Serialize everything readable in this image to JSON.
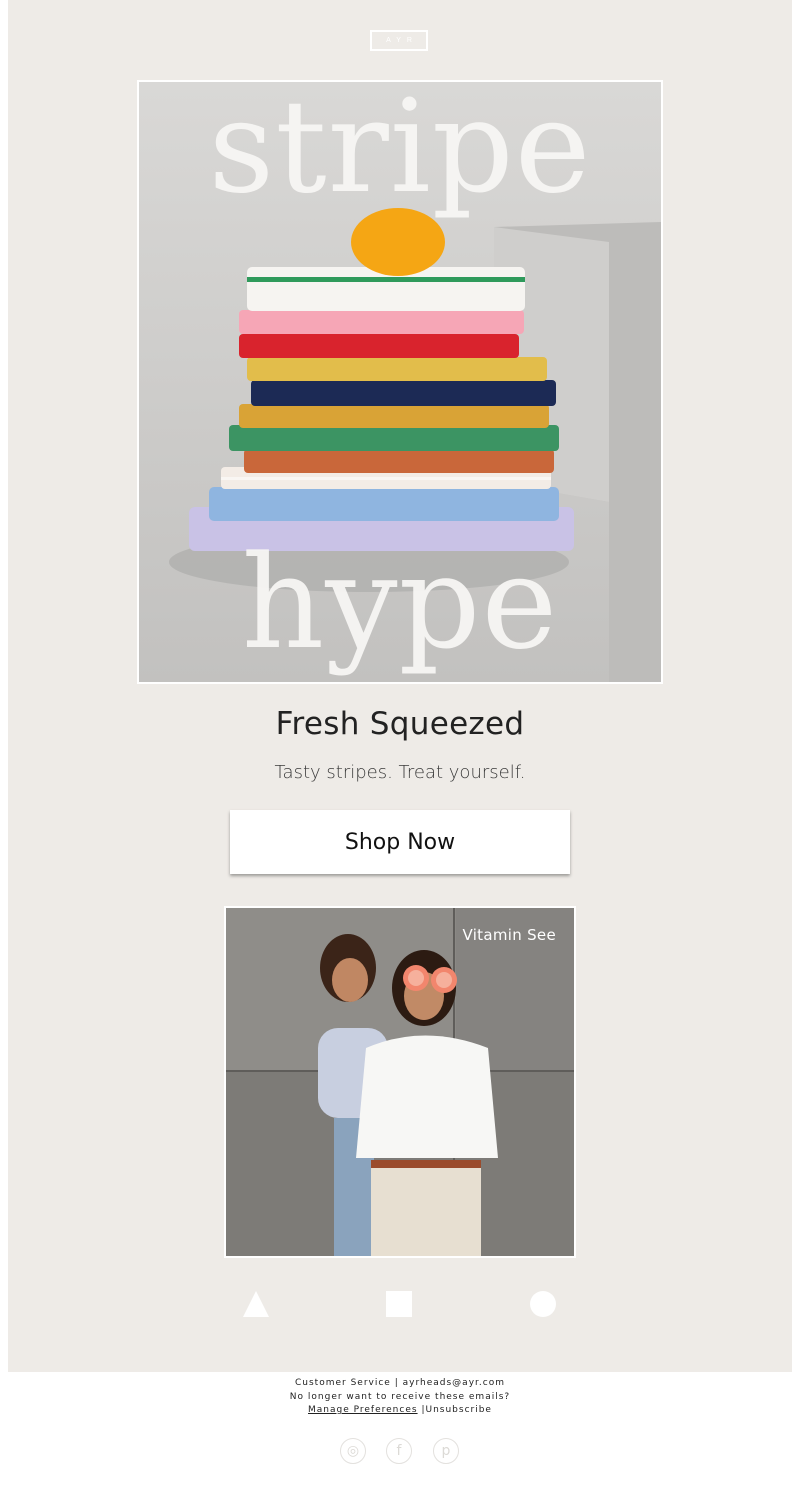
{
  "brand": {
    "logo_text": "AYR"
  },
  "hero": {
    "word_top": "stripe",
    "word_bottom": "hype"
  },
  "headline": "Fresh Squeezed",
  "subline": "Tasty stripes. Treat yourself.",
  "cta": {
    "label": "Shop Now"
  },
  "promo": {
    "caption": "Vitamin See"
  },
  "footer": {
    "customer_service": "Customer Service",
    "separator": "|",
    "email": "ayrheads@ayr.com",
    "unsubscribe_prompt": "No longer want to receive these emails?",
    "manage_preferences": "Manage Preferences",
    "unsubscribe": "Unsubscribe"
  },
  "social": [
    {
      "icon": "instagram-icon",
      "glyph": "◎"
    },
    {
      "icon": "facebook-icon",
      "glyph": "f"
    },
    {
      "icon": "pinterest-icon",
      "glyph": "p"
    }
  ],
  "colors": {
    "background": "#eeebe7",
    "text": "#222222",
    "button": "#ffffff"
  }
}
